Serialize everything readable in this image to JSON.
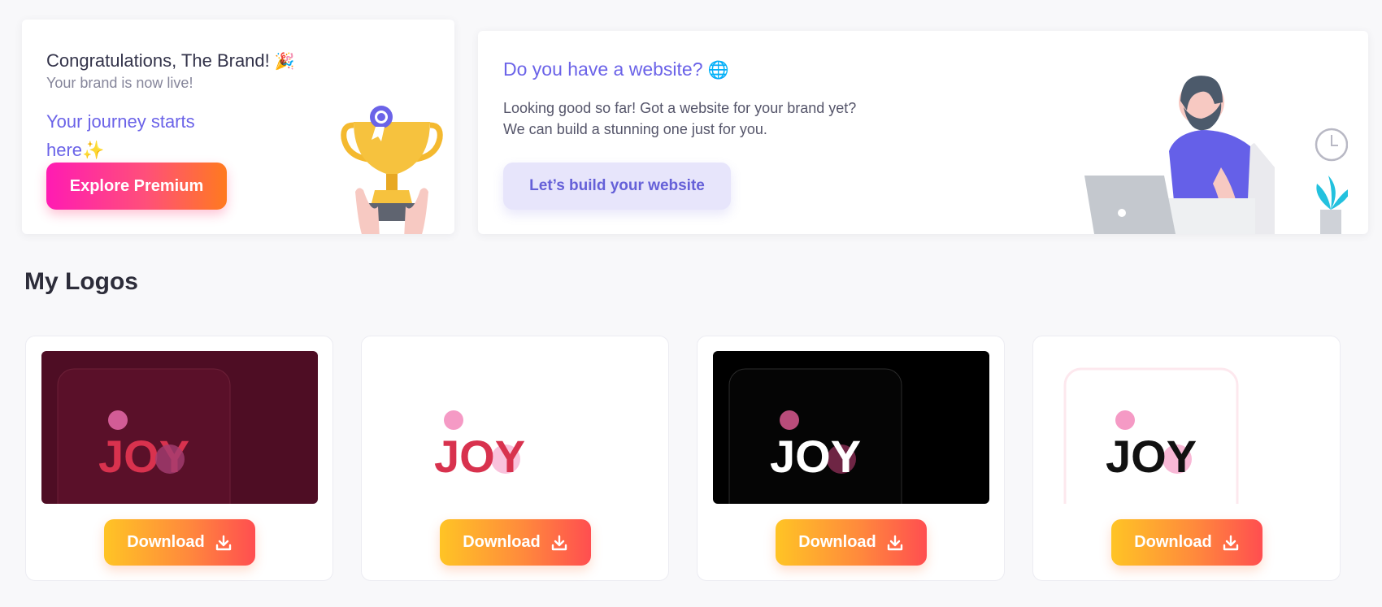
{
  "congrats": {
    "title": "Congratulations, The Brand!",
    "title_emoji": "🎉",
    "subtitle": "Your brand is now live!",
    "journey": "Your journey starts here",
    "journey_emoji": "✨",
    "premium_button": "Explore Premium"
  },
  "website": {
    "title": "Do you have a website?",
    "title_emoji": "🌐",
    "line1": "Looking good so far! Got a website for your brand yet?",
    "line2": "We can build a stunning one just for you.",
    "build_button": "Let’s build your website"
  },
  "logos": {
    "section_title": "My Logos",
    "wordmark": "JOY",
    "download_label": "Download",
    "download_icon": "download-icon",
    "variants": [
      {
        "variant": "maroon",
        "background": "#4e0d24",
        "text_color": "#d8324e",
        "dot_color": "#d25c96"
      },
      {
        "variant": "white",
        "background": "#ffffff",
        "text_color": "#d8324e",
        "dot_color": "#f59ac5"
      },
      {
        "variant": "black",
        "background": "#000000",
        "text_color": "#ffffff",
        "dot_color": "#b94c7a"
      },
      {
        "variant": "light",
        "background": "#ffffff",
        "text_color": "#111111",
        "dot_color": "#f59ac5"
      }
    ]
  },
  "colors": {
    "accent": "#6b63e8",
    "premium_gradient": [
      "#ff1bb3",
      "#ff7a1f"
    ],
    "download_gradient": [
      "#ffc425",
      "#ff4e50"
    ]
  }
}
